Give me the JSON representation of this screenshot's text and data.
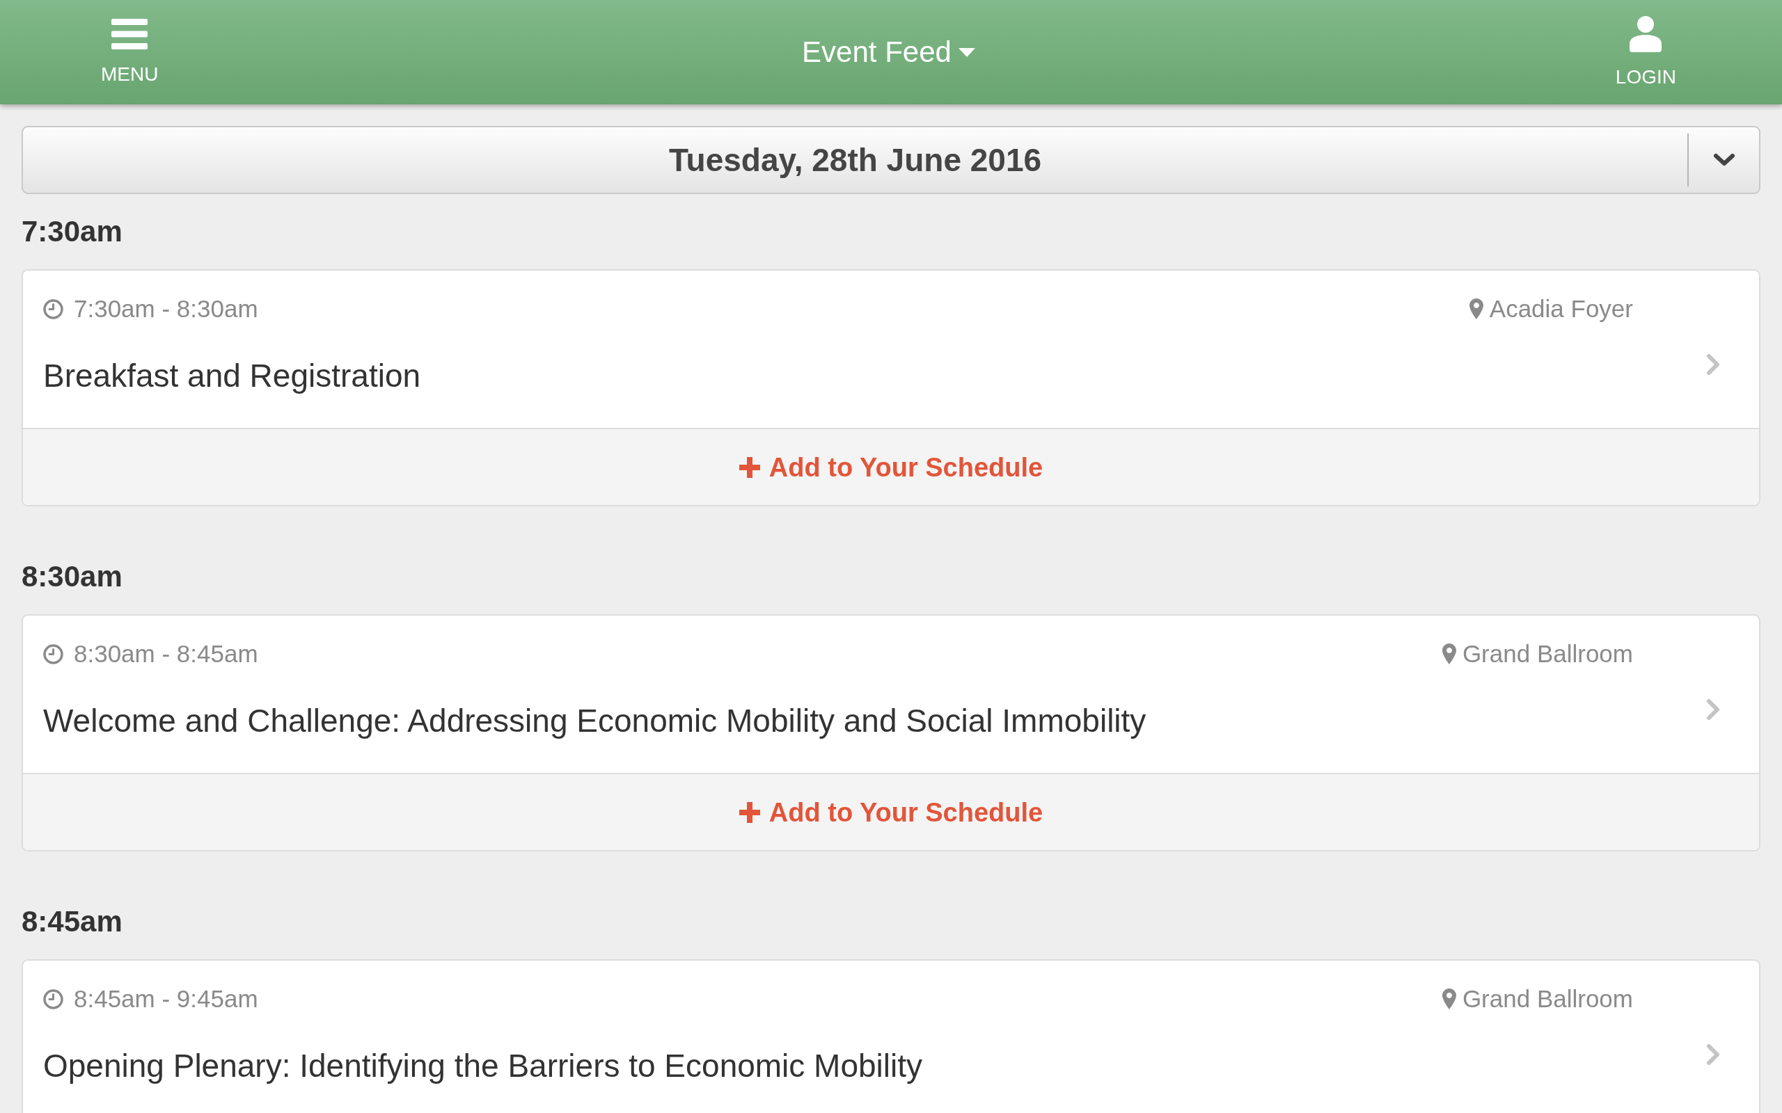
{
  "header": {
    "menu": "MENU",
    "title": "Event Feed",
    "login": "LOGIN"
  },
  "date_picker": {
    "value": "Tuesday, 28th June 2016"
  },
  "time_slots": [
    {
      "heading": "7:30am",
      "events": [
        {
          "time_range": "7:30am - 8:30am",
          "location": "Acadia Foyer",
          "title": "Breakfast and Registration",
          "action": "Add to Your Schedule"
        }
      ]
    },
    {
      "heading": "8:30am",
      "events": [
        {
          "time_range": "8:30am - 8:45am",
          "location": "Grand Ballroom",
          "title": "Welcome and Challenge: Addressing Economic Mobility and Social Immobility",
          "action": "Add to Your Schedule"
        }
      ]
    },
    {
      "heading": "8:45am",
      "events": [
        {
          "time_range": "8:45am - 9:45am",
          "location": "Grand Ballroom",
          "title": "Opening Plenary: Identifying the Barriers to Economic Mobility"
        }
      ]
    }
  ]
}
